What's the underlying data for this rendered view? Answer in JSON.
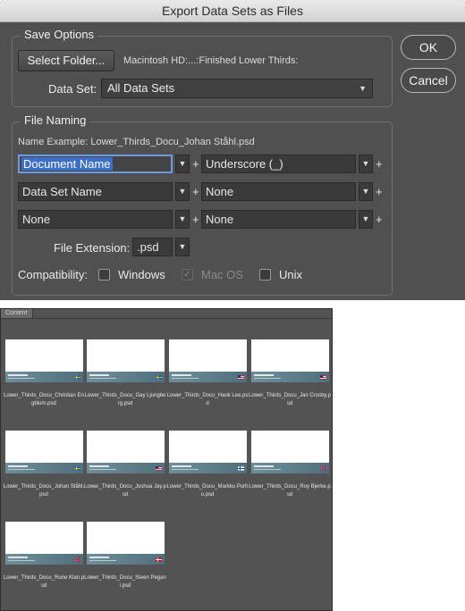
{
  "window": {
    "title": "Export Data Sets as Files"
  },
  "buttons": {
    "ok": "OK",
    "cancel": "Cancel"
  },
  "save_options": {
    "title": "Save Options",
    "select_folder": "Select Folder...",
    "folder_path": "Macintosh HD:...:Finished Lower Thirds:",
    "data_set_label": "Data Set:",
    "data_set_value": "All Data Sets"
  },
  "file_naming": {
    "title": "File Naming",
    "name_example_label": "Name Example:",
    "name_example_value": "Lower_Thirds_Docu_Johan Ståhl.psd",
    "rows": [
      {
        "left": "Document Name",
        "right": "Underscore (_)"
      },
      {
        "left": "Data Set Name",
        "right": "None"
      },
      {
        "left": "None",
        "right": "None"
      }
    ],
    "file_extension_label": "File Extension:",
    "file_extension_value": ".psd",
    "compatibility_label": "Compatibility:",
    "windows": "Windows",
    "mac": "Mac OS",
    "unix": "Unix"
  },
  "content_panel": {
    "tab": "Content",
    "files": [
      {
        "caption": "Lower_Thirds_Docu_Christian Engblom.psd",
        "flag": "sweden"
      },
      {
        "caption": "Lower_Thirds_Docu_Gay Ljungberg.psd",
        "flag": "sweden"
      },
      {
        "caption": "Lower_Thirds_Docu_Hank Lee.psd",
        "flag": "usa"
      },
      {
        "caption": "Lower_Thirds_Docu_Jan Crosby.psd",
        "flag": "usa"
      },
      {
        "caption": "Lower_Thirds_Docu_Johan Ståhl.psd",
        "flag": "sweden"
      },
      {
        "caption": "Lower_Thirds_Docu_Joshua Jay.psd",
        "flag": "usa"
      },
      {
        "caption": "Lower_Thirds_Docu_Markku Purho.psd",
        "flag": "finland"
      },
      {
        "caption": "Lower_Thirds_Docu_Roy Bjerke.psd",
        "flag": "norway"
      },
      {
        "caption": "Lower_Thirds_Docu_Rune Klan.psd",
        "flag": "norway"
      },
      {
        "caption": "Lower_Thirds_Docu_Steen Pegani.psd",
        "flag": "denmark"
      }
    ]
  },
  "colors": {
    "dialog_bg": "#505050",
    "focus": "#6d9be3",
    "selection": "#3e6fc7"
  }
}
